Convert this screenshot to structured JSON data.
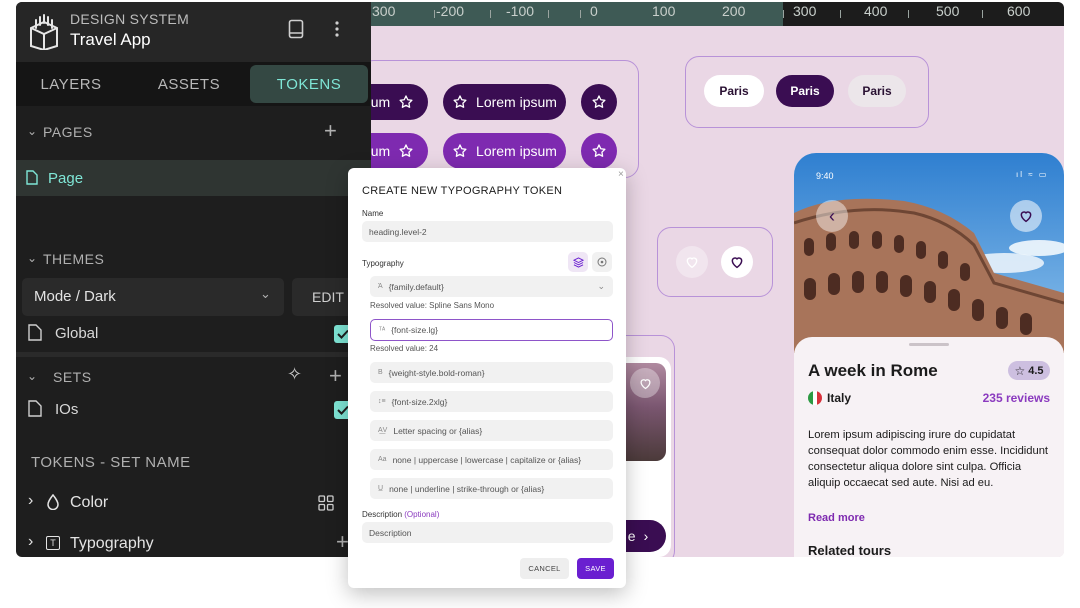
{
  "header": {
    "subtitle": "DESIGN SYSTEM",
    "title": "Travel App"
  },
  "tabs": [
    "LAYERS",
    "ASSETS",
    "TOKENS"
  ],
  "pages": {
    "label": "PAGES",
    "item": "Page"
  },
  "themes": {
    "label": "THEMES",
    "mode": "Mode / Dark",
    "edit": "EDIT",
    "item": "Global"
  },
  "sets": {
    "label": "SETS",
    "item": "IOs"
  },
  "tokens": {
    "label": "TOKENS - SET NAME",
    "items": [
      "Color",
      "Typography"
    ]
  },
  "ruler": [
    "300",
    "-200",
    "-100",
    "0",
    "100",
    "200",
    "300",
    "400",
    "500",
    "600"
  ],
  "canvas": {
    "button_label": "Lorem ipsum",
    "button_label_cut": "sum",
    "chips": [
      "Paris",
      "Paris",
      "Paris"
    ],
    "card_button_cut": "e"
  },
  "phone": {
    "time": "9:40",
    "title": "A week in Rome",
    "rating": "4.5",
    "country": "Italy",
    "reviews": "235 reviews",
    "description": "Lorem ipsum adipiscing irure do cupidatat consequat dolor commodo enim esse. Incididunt consectetur aliqua dolore sint culpa. Officia aliquip occaecat sed aute. Nisi ad eu.",
    "read_more": "Read more",
    "related": "Related tours"
  },
  "modal": {
    "title": "CREATE NEW TYPOGRAPHY TOKEN",
    "name_label": "Name",
    "name_value": "heading.level-2",
    "typography_label": "Typography",
    "family": "{family.default}",
    "family_resolved": "Resolved value: Spline Sans Mono",
    "size": "{font-size.lg}",
    "size_resolved": "Resolved value: 24",
    "weight": "{weight-style.bold-roman}",
    "line_height": "{font-size.2xlg}",
    "letter_spacing": "Letter spacing or {alias}",
    "case": "none | uppercase | lowercase | capitalize or {alias}",
    "decoration": "none | underline | strike-through or {alias}",
    "description_label": "Description",
    "description_optional": "(Optional)",
    "description_placeholder": "Description",
    "cancel": "CANCEL",
    "save": "SAVE"
  },
  "colors": {
    "panel_bg": "#1e1e1e",
    "accent_teal": "#7fe6d6",
    "canvas_bg": "#ead7e5",
    "brand_purple_dark": "#3a0d52",
    "brand_purple": "#7e2ab0",
    "save_button": "#6a1fd0"
  }
}
